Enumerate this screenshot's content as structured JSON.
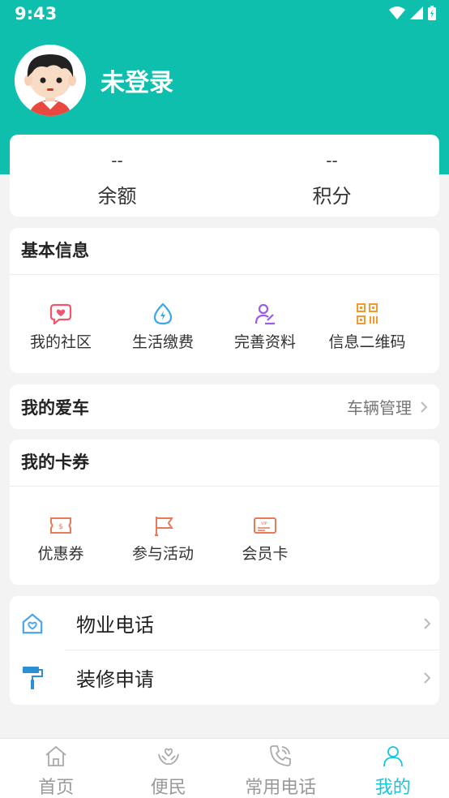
{
  "status_bar": {
    "time": "9:43"
  },
  "profile": {
    "login_status": "未登录"
  },
  "balance": {
    "items": [
      {
        "value": "--",
        "label": "余额"
      },
      {
        "value": "--",
        "label": "积分"
      }
    ]
  },
  "basic_info": {
    "title": "基本信息",
    "items": [
      {
        "label": "我的社区",
        "icon": "heart-chat-icon"
      },
      {
        "label": "生活缴费",
        "icon": "water-bolt-icon"
      },
      {
        "label": "完善资料",
        "icon": "user-edit-icon"
      },
      {
        "label": "信息二维码",
        "icon": "qrcode-icon"
      }
    ]
  },
  "my_car": {
    "title": "我的爱车",
    "action": "车辆管理"
  },
  "coupons": {
    "title": "我的卡券",
    "items": [
      {
        "label": "优惠券",
        "icon": "coupon-icon"
      },
      {
        "label": "参与活动",
        "icon": "flag-icon"
      },
      {
        "label": "会员卡",
        "icon": "vip-card-icon"
      }
    ]
  },
  "services": [
    {
      "label": "物业电话",
      "icon": "house-heart-icon"
    },
    {
      "label": "装修申请",
      "icon": "paint-roller-icon"
    }
  ],
  "tabbar": {
    "tabs": [
      {
        "label": "首页",
        "icon": "home-icon"
      },
      {
        "label": "便民",
        "icon": "hands-heart-icon"
      },
      {
        "label": "常用电话",
        "icon": "phone-icon"
      },
      {
        "label": "我的",
        "icon": "user-icon"
      }
    ],
    "active_index": 3
  },
  "colors": {
    "brand": "#0dbfac",
    "tab_active": "#16c5e0",
    "community_icon": "#f0566e",
    "payment_icon": "#38a8e8",
    "profile_icon": "#9a5be8",
    "qrcode_icon": "#f29a2e",
    "coupon_icon": "#e8795a",
    "property_icon": "#4aa6e8"
  }
}
